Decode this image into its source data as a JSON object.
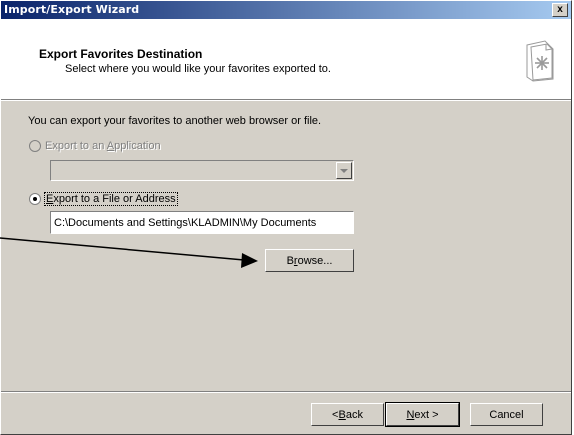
{
  "window": {
    "title": "Import/Export Wizard",
    "close_glyph": "x"
  },
  "header": {
    "title": "Export Favorites Destination",
    "subtitle": "Select where you would like your favorites exported to.",
    "icon": "favorites-page-icon"
  },
  "body": {
    "intro": "You can export your favorites to another web browser or file.",
    "option_application": {
      "prefix": "Export to an ",
      "accel": "A",
      "suffix": "pplication",
      "selected": false,
      "enabled": false
    },
    "option_file": {
      "accel": "E",
      "suffix": "xport to a File or Address",
      "selected": true,
      "enabled": true
    },
    "application_combo": {
      "value": "",
      "enabled": false
    },
    "path_input": {
      "value": "C:\\Documents and Settings\\KLADMIN\\My Documents"
    },
    "browse_button": {
      "prefix": "B",
      "accel": "r",
      "suffix": "owse..."
    }
  },
  "footer": {
    "back": {
      "prefix": "< ",
      "accel": "B",
      "suffix": "ack"
    },
    "next": {
      "accel": "N",
      "suffix": "ext >"
    },
    "cancel": "Cancel"
  },
  "colors": {
    "dialog_bg": "#d4d0c8",
    "titlebar_start": "#0a246a",
    "titlebar_end": "#a6caf0",
    "header_bg": "#ffffff",
    "disabled_text": "#808080"
  }
}
